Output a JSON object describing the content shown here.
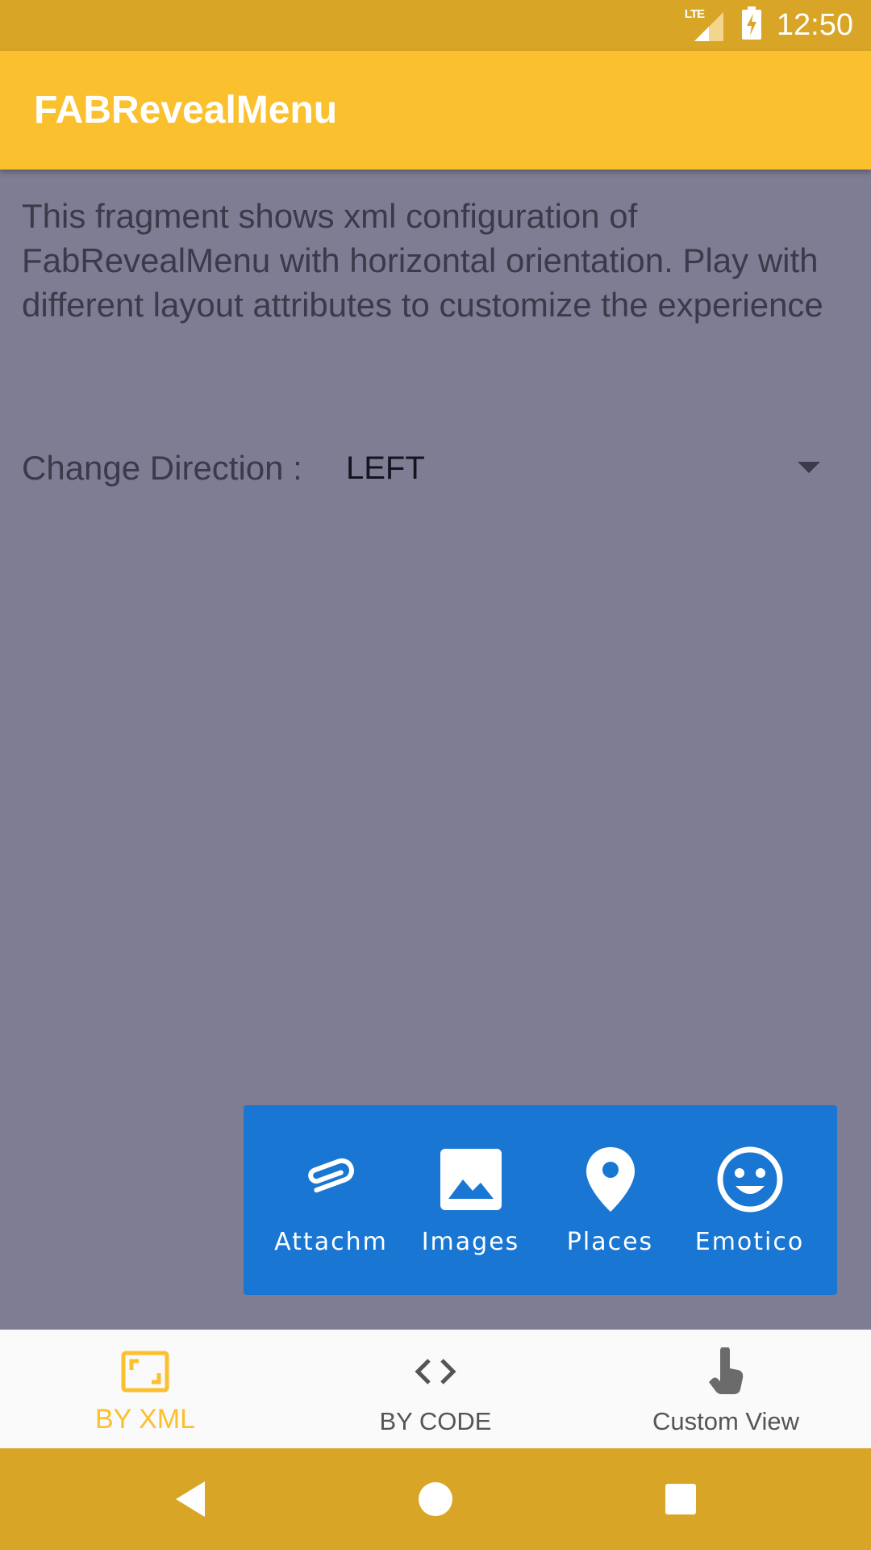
{
  "status_bar": {
    "network": "LTE",
    "time": "12:50",
    "icons": [
      "signal-lte-icon",
      "battery-charging-icon"
    ]
  },
  "app_bar": {
    "title": "FABRevealMenu"
  },
  "main": {
    "description": "This fragment shows xml configuration of FabRevealMenu with horizontal orientation. Play with different layout attributes to customize the experience",
    "direction_label": "Change Direction :",
    "direction_value": "LEFT"
  },
  "reveal_menu": {
    "background_color": "#1976d2",
    "items": [
      {
        "label": "Attachm",
        "icon": "attachment-icon"
      },
      {
        "label": "Images",
        "icon": "image-icon"
      },
      {
        "label": "Places",
        "icon": "place-icon"
      },
      {
        "label": "Emotico",
        "icon": "emoticon-icon"
      }
    ]
  },
  "bottom_nav": {
    "items": [
      {
        "label": "BY XML",
        "icon": "crop-free-icon",
        "active": true
      },
      {
        "label": "BY CODE",
        "icon": "code-icon",
        "active": false
      },
      {
        "label": "Custom View",
        "icon": "touch-icon",
        "active": false
      }
    ],
    "active_color": "#fbc02d"
  },
  "system_nav": {
    "buttons": [
      "back-icon",
      "home-icon",
      "recents-icon"
    ]
  },
  "colors": {
    "primary": "#fbc02d",
    "primary_dark": "#d8a526",
    "scrim": "#7f7d93"
  }
}
